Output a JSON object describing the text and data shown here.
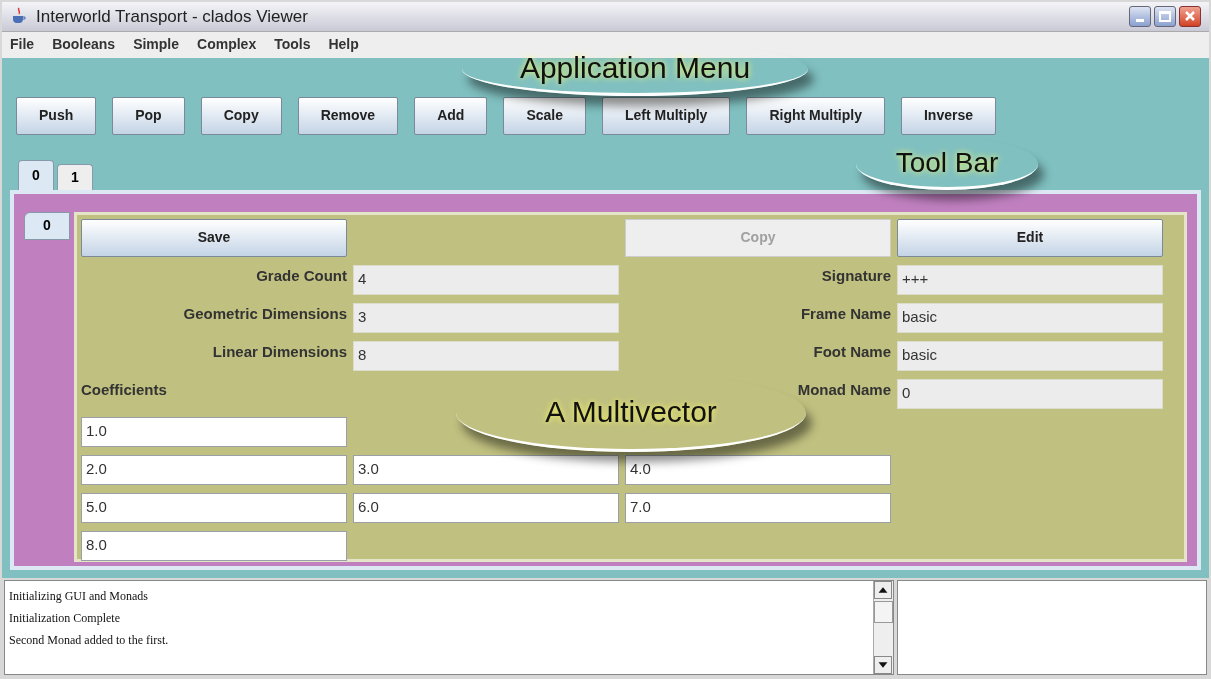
{
  "window": {
    "title": "Interworld Transport - clados Viewer"
  },
  "menu": [
    "File",
    "Booleans",
    "Simple",
    "Complex",
    "Tools",
    "Help"
  ],
  "toolbar": [
    "Push",
    "Pop",
    "Copy",
    "Remove",
    "Add",
    "Scale",
    "Left Multiply",
    "Right Multiply",
    "Inverse"
  ],
  "tabs": [
    {
      "label": "0",
      "selected": true
    },
    {
      "label": "1",
      "selected": false
    }
  ],
  "inner_tabs": [
    {
      "label": "0",
      "selected": true
    }
  ],
  "panel": {
    "buttons": [
      {
        "label": "Save",
        "disabled": false
      },
      {
        "label": "Copy",
        "disabled": true
      },
      {
        "label": "Edit",
        "disabled": false
      }
    ],
    "left_fields": [
      {
        "label": "Grade Count",
        "value": "4"
      },
      {
        "label": "Geometric Dimensions",
        "value": "3"
      },
      {
        "label": "Linear Dimensions",
        "value": "8"
      }
    ],
    "right_fields": [
      {
        "label": "Signature",
        "value": "+++"
      },
      {
        "label": "Frame Name",
        "value": "basic"
      },
      {
        "label": "Foot Name",
        "value": "basic"
      },
      {
        "label": "Monad Name",
        "value": "0"
      }
    ],
    "coefficients_label": "Coefficients",
    "coefficients": [
      [
        "1.0"
      ],
      [
        "2.0",
        "3.0",
        "4.0"
      ],
      [
        "5.0",
        "6.0",
        "7.0"
      ],
      [
        "8.0"
      ]
    ]
  },
  "log": [
    "Initializing GUI and Monads",
    "Initialization Complete",
    "Second Monad added to the first."
  ],
  "annotations": [
    "Application Menu",
    "Tool Bar",
    "A Multivector"
  ]
}
